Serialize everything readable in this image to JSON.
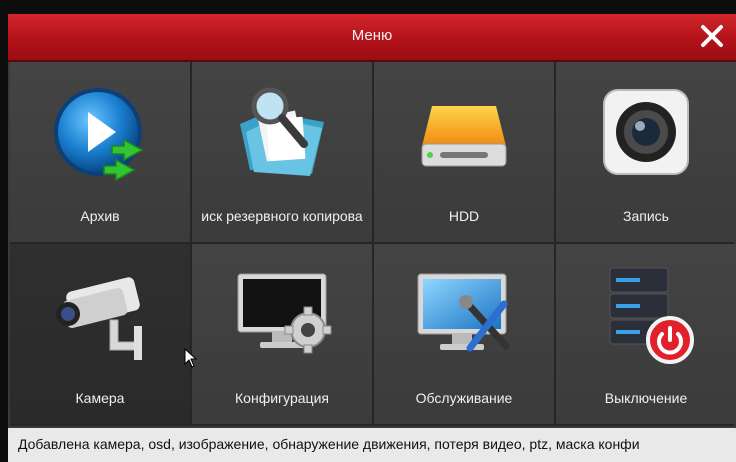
{
  "window": {
    "title": "Меню",
    "close_icon": "close-icon"
  },
  "menu": {
    "items": [
      {
        "label": "Архив",
        "icon": "playback-icon"
      },
      {
        "label": "иск резервного копирова",
        "icon": "backup-folder-icon"
      },
      {
        "label": "HDD",
        "icon": "hdd-icon"
      },
      {
        "label": "Запись",
        "icon": "record-camera-icon"
      },
      {
        "label": "Камера",
        "icon": "cctv-camera-icon"
      },
      {
        "label": "Конфигурация",
        "icon": "monitor-gear-icon"
      },
      {
        "label": "Обслуживание",
        "icon": "monitor-tools-icon"
      },
      {
        "label": "Выключение",
        "icon": "server-power-icon"
      }
    ],
    "selected_index": 4
  },
  "status": {
    "text": "Добавлена камера, osd, изображение, обнаружение движения, потеря видео, ptz, маска конфи"
  },
  "colors": {
    "titlebar": "#c4161d",
    "tile": "#404040",
    "status_bar": "#e9e9e9",
    "accent_blue": "#1f8fd6"
  }
}
